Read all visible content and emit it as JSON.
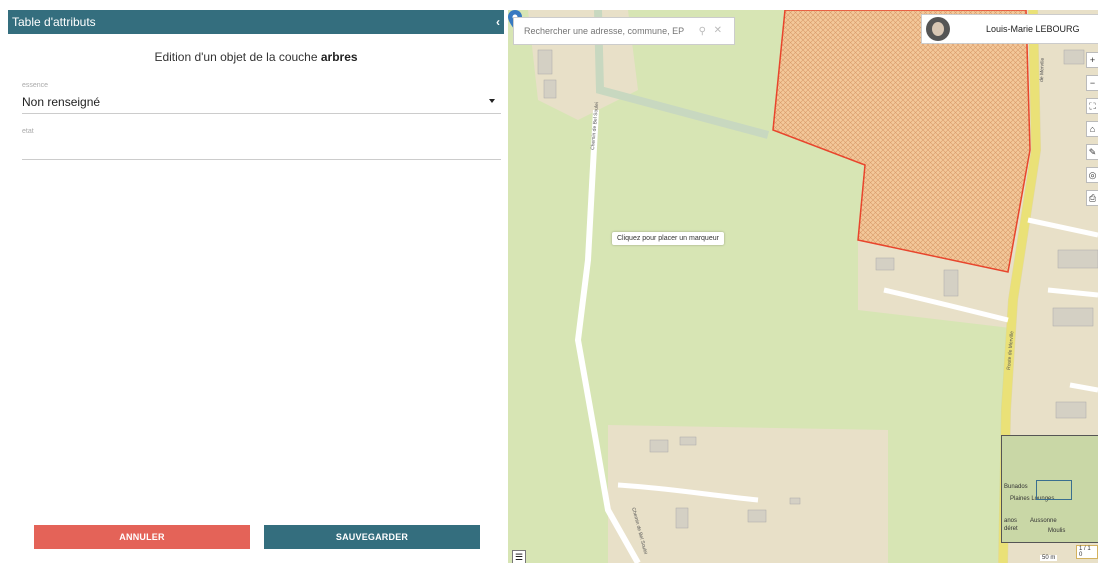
{
  "panel": {
    "title": "Table d'attributs",
    "collapse_icon": "chevron-left-icon",
    "subtitle_prefix": "Edition d'un objet de la couche ",
    "layer_name": "arbres",
    "fields": [
      {
        "label": "essence",
        "value": "Non renseigné",
        "type": "select"
      },
      {
        "label": "etat",
        "value": "",
        "type": "text"
      }
    ],
    "cancel_label": "ANNULER",
    "save_label": "SAUVEGARDER",
    "colors": {
      "header": "#346e7e",
      "cancel": "#e46358",
      "save": "#346e7e"
    }
  },
  "map": {
    "search": {
      "placeholder": "Rechercher une adresse, commune, EPCI..."
    },
    "user": {
      "name": "Louis-Marie LEBOURG"
    },
    "tooltip": "Cliquez pour placer un marqueur",
    "tools": [
      "zoom-in-icon",
      "zoom-out-icon",
      "fullscreen-icon",
      "home-icon",
      "draw-icon",
      "locate-icon",
      "print-icon"
    ],
    "road_labels": [
      "Chemin de Bel Soulei",
      "Route de Merville",
      "de Merville",
      "Chemin de Bel Soulei"
    ],
    "minimap": {
      "labels": [
        "Bunados",
        "Plaines Lounges",
        "Aussonne",
        "Moulis",
        "anos",
        "déret"
      ]
    },
    "scale": "50 m",
    "page_indicator": "1 / 1 0",
    "colors": {
      "background": "#d7e5b4",
      "parcel_fill": "#f3c89a",
      "parcel_border": "#e8452c",
      "main_road": "#f6ef7e"
    }
  }
}
